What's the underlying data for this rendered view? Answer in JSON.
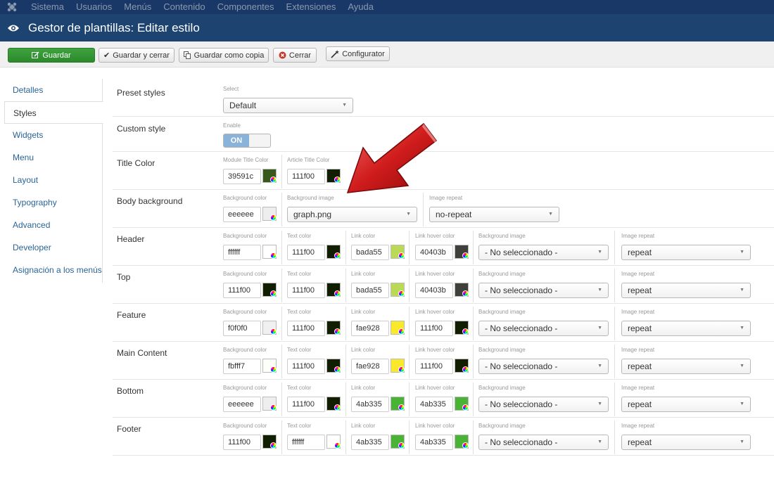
{
  "topbar": {
    "menu": [
      "Sistema",
      "Usuarios",
      "Menús",
      "Contenido",
      "Componentes",
      "Extensiones",
      "Ayuda"
    ]
  },
  "header": {
    "title": "Gestor de plantillas: Editar estilo"
  },
  "toolbar": {
    "save": "Guardar",
    "save_close": "Guardar y cerrar",
    "save_copy": "Guardar como copia",
    "close": "Cerrar",
    "configurator": "Configurator"
  },
  "sidebar": {
    "items": [
      "Detalles",
      "Styles",
      "Widgets",
      "Menu",
      "Layout",
      "Typography",
      "Advanced",
      "Developer",
      "Asignación a los menús"
    ],
    "active": "Styles"
  },
  "preset": {
    "label": "Preset styles",
    "sublabel": "Select",
    "value": "Default"
  },
  "custom": {
    "label": "Custom style",
    "sublabel": "Enable",
    "value": "ON"
  },
  "title_color": {
    "label": "Title Color",
    "module_label": "Module Title Color",
    "module_value": "39591c",
    "article_label": "Article Title Color",
    "article_value": "111f00"
  },
  "body_bg": {
    "label": "Body background",
    "bg_label": "Background color",
    "bg_value": "eeeeee",
    "img_label": "Background image",
    "img_value": "graph.png",
    "repeat_label": "Image repeat",
    "repeat_value": "no-repeat"
  },
  "col_labels": {
    "bg": "Background color",
    "text": "Text color",
    "link": "Link color",
    "hover": "Link hover color",
    "image": "Background image",
    "repeat": "Image repeat"
  },
  "rows": [
    {
      "label": "Header",
      "bg": "ffffff",
      "text": "111f00",
      "link": "bada55",
      "hover": "40403b",
      "image": "- No seleccionado -",
      "repeat": "repeat"
    },
    {
      "label": "Top",
      "bg": "111f00",
      "text": "111f00",
      "link": "bada55",
      "hover": "40403b",
      "image": "- No seleccionado -",
      "repeat": "repeat"
    },
    {
      "label": "Feature",
      "bg": "f0f0f0",
      "text": "111f00",
      "link": "fae928",
      "hover": "111f00",
      "image": "- No seleccionado -",
      "repeat": "repeat"
    },
    {
      "label": "Main Content",
      "bg": "fbfff7",
      "text": "111f00",
      "link": "fae928",
      "hover": "111f00",
      "image": "- No seleccionado -",
      "repeat": "repeat"
    },
    {
      "label": "Bottom",
      "bg": "eeeeee",
      "text": "111f00",
      "link": "4ab335",
      "hover": "4ab335",
      "image": "- No seleccionado -",
      "repeat": "repeat"
    },
    {
      "label": "Footer",
      "bg": "111f00",
      "text": "ffffff",
      "link": "4ab335",
      "hover": "4ab335",
      "image": "- No seleccionado -",
      "repeat": "repeat"
    }
  ],
  "colors": {
    "topbar": "#1a3867",
    "titlebar": "#1d4371",
    "primary": "#2c8a2c",
    "link": "#2a6496",
    "arrow": "#c41414"
  }
}
